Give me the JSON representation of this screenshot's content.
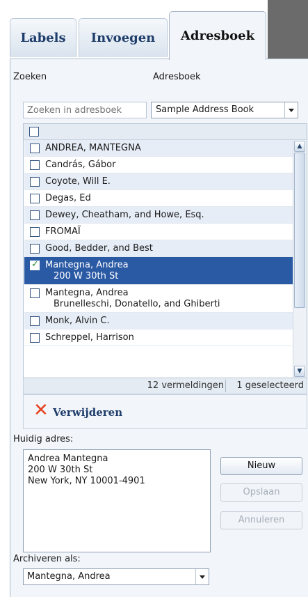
{
  "tabs": [
    {
      "label": "Labels"
    },
    {
      "label": "Invoegen"
    },
    {
      "label": "Adresboek"
    }
  ],
  "search": {
    "label": "Zoeken",
    "placeholder": "Zoeken in adresboek"
  },
  "address_book": {
    "label": "Adresboek",
    "selected": "Sample Address Book"
  },
  "contacts": [
    {
      "name": "ANDREA, MANTEGNA",
      "checked": false
    },
    {
      "name": "Candrás, Gábor",
      "checked": false
    },
    {
      "name": "Coyote, Will E.",
      "checked": false
    },
    {
      "name": "Degas, Ed",
      "checked": false
    },
    {
      "name": "Dewey, Cheatham, and Howe, Esq.",
      "checked": false
    },
    {
      "name": "FROMAÏ",
      "checked": false
    },
    {
      "name": "Good, Bedder, and Best",
      "checked": false
    },
    {
      "name": "Mantegna, Andrea",
      "sub": "200 W 30th St",
      "checked": true
    },
    {
      "name": "Mantegna, Andrea",
      "sub": "Brunelleschi, Donatello, and Ghiberti",
      "checked": false
    },
    {
      "name": "Monk, Alvin C.",
      "checked": false
    },
    {
      "name": "Schreppel, Harrison",
      "checked": false
    }
  ],
  "footer": {
    "count": "12 vermeldingen",
    "selected": "1 geselecteerd"
  },
  "delete_label": "Verwijderen",
  "current_address": {
    "label": "Huidig adres:",
    "value": "Andrea Mantegna\n200 W 30th St\nNew York, NY 10001-4901"
  },
  "buttons": {
    "new": "Nieuw",
    "save": "Opslaan",
    "cancel": "Annuleren"
  },
  "archive": {
    "label": "Archiveren als:",
    "selected": "Mantegna, Andrea"
  }
}
